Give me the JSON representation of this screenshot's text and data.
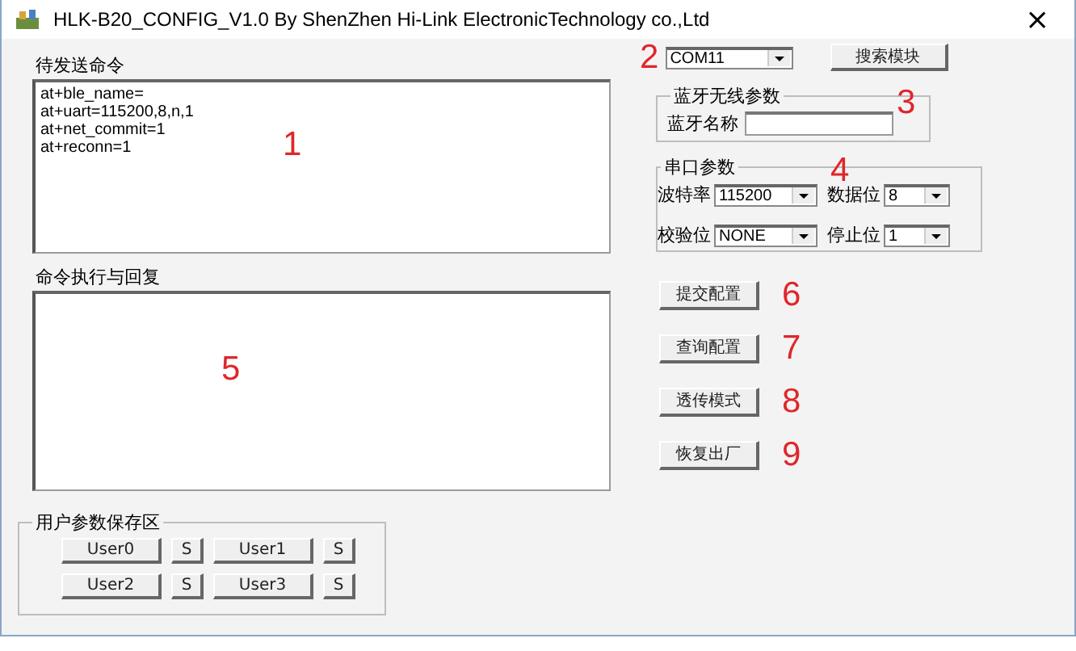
{
  "window": {
    "title": "HLK-B20_CONFIG_V1.0 By ShenZhen Hi-Link ElectronicTechnology co.,Ltd",
    "close": "×"
  },
  "send_commands": {
    "label": "待发送命令",
    "marker": "1",
    "lines": [
      "at+ble_name=",
      "at+uart=115200,8,n,1",
      "at+net_commit=1",
      "at+reconn=1"
    ]
  },
  "response": {
    "label": "命令执行与回复",
    "marker": "5"
  },
  "user_params": {
    "label": "用户参数保存区",
    "slots": [
      {
        "name": "User0",
        "save": "S"
      },
      {
        "name": "User1",
        "save": "S"
      },
      {
        "name": "User2",
        "save": "S"
      },
      {
        "name": "User3",
        "save": "S"
      }
    ]
  },
  "port": {
    "marker": "2",
    "value": "COM11",
    "search_button": "搜索模块"
  },
  "bluetooth": {
    "label": "蓝牙无线参数",
    "marker": "3",
    "name_label": "蓝牙名称"
  },
  "serial": {
    "label": "串口参数",
    "marker": "4",
    "fields": [
      {
        "label": "波特率",
        "value": "115200"
      },
      {
        "label": "数据位",
        "value": "8"
      },
      {
        "label": "校验位",
        "value": "NONE"
      },
      {
        "label": "停止位",
        "value": "1"
      }
    ]
  },
  "actions": [
    {
      "label": "提交配置",
      "marker": "6"
    },
    {
      "label": "查询配置",
      "marker": "7"
    },
    {
      "label": "透传模式",
      "marker": "8"
    },
    {
      "label": "恢复出厂",
      "marker": "9"
    }
  ]
}
